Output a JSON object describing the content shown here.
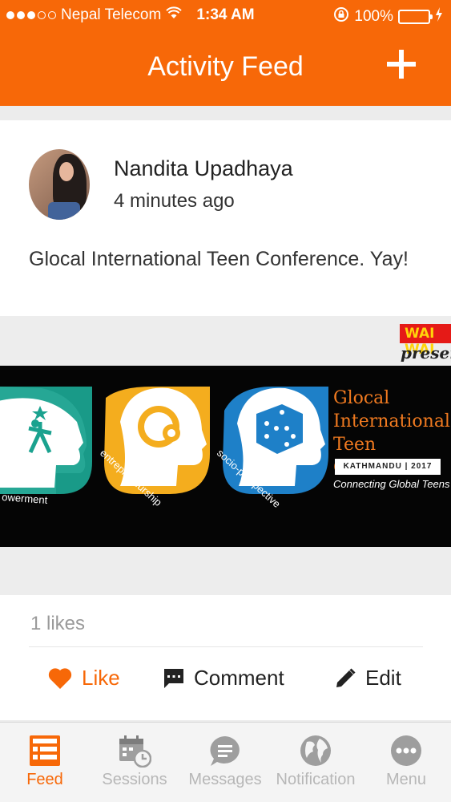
{
  "status_bar": {
    "carrier": "Nepal Telecom",
    "time": "1:34 AM",
    "battery": "100%",
    "battery_level": 1.0,
    "icons": [
      "signal-dots-icon",
      "wifi-icon",
      "rotation-lock-icon",
      "battery-icon",
      "charging-icon"
    ]
  },
  "header": {
    "title": "Activity Feed",
    "add_icon": "plus-icon"
  },
  "post": {
    "user_name": "Nandita Upadhaya",
    "time_ago": "4 minutes ago",
    "text": "Glocal International Teen Conference. Yay!",
    "banner": {
      "brand": "WAI WAI",
      "presents": "presents",
      "labels": [
        "owerment",
        "entrepreneurship",
        "socio-perspective"
      ],
      "conference_title": "Glocal International Teen Conference",
      "location": "KATHMANDU | 2017",
      "tagline": "Connecting Global Teens"
    },
    "likes": "1 likes",
    "actions": {
      "like": "Like",
      "comment": "Comment",
      "edit": "Edit"
    }
  },
  "tabbar": {
    "items": [
      {
        "label": "Feed",
        "icon": "feed-icon",
        "active": true
      },
      {
        "label": "Sessions",
        "icon": "calendar-clock-icon",
        "active": false
      },
      {
        "label": "Messages",
        "icon": "message-bubble-icon",
        "active": false
      },
      {
        "label": "Notification",
        "icon": "globe-icon",
        "active": false
      },
      {
        "label": "Menu",
        "icon": "more-icon",
        "active": false
      }
    ]
  },
  "colors": {
    "brand_orange": "#f76808",
    "battery_green": "#3ed04a",
    "inactive_gray": "#b7b7b7"
  }
}
